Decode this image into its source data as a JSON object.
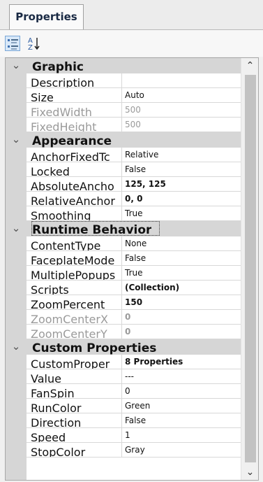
{
  "tab": {
    "label": "Properties"
  },
  "toolbar": {
    "categorized_icon": "categorized-view-icon",
    "alpha_icon": "alphabetical-sort-icon",
    "alpha_letters": {
      "top": "A",
      "bottom": "Z"
    }
  },
  "categories": [
    {
      "title": "Graphic",
      "properties": [
        {
          "name": "Description",
          "value": ""
        },
        {
          "name": "Size",
          "value": "Auto"
        },
        {
          "name": "FixedWidth",
          "value": "500",
          "disabled": true
        },
        {
          "name": "FixedHeight",
          "value": "500",
          "disabled": true
        }
      ]
    },
    {
      "title": "Appearance",
      "properties": [
        {
          "name": "AnchorFixedTc",
          "value": "Relative"
        },
        {
          "name": "Locked",
          "value": "False"
        },
        {
          "name": "AbsoluteAncho",
          "value": "125, 125",
          "bold": true
        },
        {
          "name": "RelativeAnchor",
          "value": "0, 0",
          "bold": true
        },
        {
          "name": "Smoothing",
          "value": "True"
        }
      ]
    },
    {
      "title": "Runtime Behavior",
      "properties": [
        {
          "name": "ContentType",
          "value": "None"
        },
        {
          "name": "FaceplateMode",
          "value": "False"
        },
        {
          "name": "MultiplePopups",
          "value": "True"
        },
        {
          "name": "Scripts",
          "value": "(Collection)",
          "bold": true
        },
        {
          "name": "ZoomPercent",
          "value": "150",
          "bold": true
        },
        {
          "name": "ZoomCenterX",
          "value": "0",
          "disabled": true,
          "bold": true
        },
        {
          "name": "ZoomCenterY",
          "value": "0",
          "disabled": true,
          "bold": true
        }
      ]
    },
    {
      "title": "Custom Properties",
      "properties": [
        {
          "name": "CustomProper",
          "value": "8 Properties",
          "bold": true
        },
        {
          "name": "Value",
          "value": "---"
        },
        {
          "name": "FanSpin",
          "value": "0"
        },
        {
          "name": "RunColor",
          "value": "Green"
        },
        {
          "name": "Direction",
          "value": "False"
        },
        {
          "name": "Speed",
          "value": "1"
        },
        {
          "name": "StopColor",
          "value": "Gray"
        }
      ]
    }
  ],
  "icons": {
    "collapse": "chevron-down-icon",
    "scroll_up": "scroll-up-arrow-icon",
    "scroll_down": "scroll-down-arrow-icon"
  },
  "glyphs": {
    "chevron": "⌄",
    "up": "⌃",
    "down": "⌄"
  }
}
